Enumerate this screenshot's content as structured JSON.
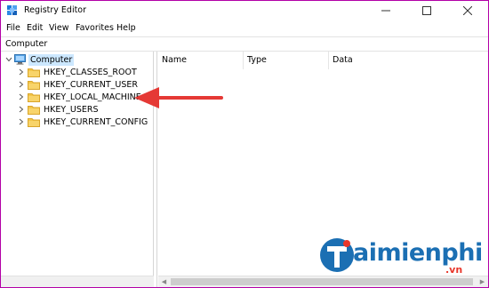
{
  "window": {
    "title": "Registry Editor",
    "border_color": "#b300a7"
  },
  "controls": {
    "minimize": "—",
    "maximize": "□",
    "close": "✕"
  },
  "menu": {
    "file": "File",
    "edit": "Edit",
    "view": "View",
    "favorites": "Favorites",
    "help": "Help"
  },
  "address": {
    "path": "Computer"
  },
  "tree": {
    "root": {
      "label": "Computer",
      "icon": "computer-icon",
      "expanded": true,
      "selected": true
    },
    "hives": [
      {
        "label": "HKEY_CLASSES_ROOT",
        "icon": "folder-icon"
      },
      {
        "label": "HKEY_CURRENT_USER",
        "icon": "folder-icon"
      },
      {
        "label": "HKEY_LOCAL_MACHINE",
        "icon": "folder-icon"
      },
      {
        "label": "HKEY_USERS",
        "icon": "folder-icon"
      },
      {
        "label": "HKEY_CURRENT_CONFIG",
        "icon": "folder-icon"
      }
    ]
  },
  "list": {
    "columns": [
      "Name",
      "Type",
      "Data"
    ]
  },
  "annotation": {
    "arrow_color": "#e53935",
    "points_to": "HKEY_LOCAL_MACHINE"
  },
  "watermark": {
    "text": "aimienphi",
    "suffix": ".vn",
    "brand_color": "#1b6fb3",
    "accent_color": "#e8372b"
  },
  "icons": {
    "expand_open": "∨",
    "expand_closed": ">",
    "expand_closed_glyph": "›"
  }
}
